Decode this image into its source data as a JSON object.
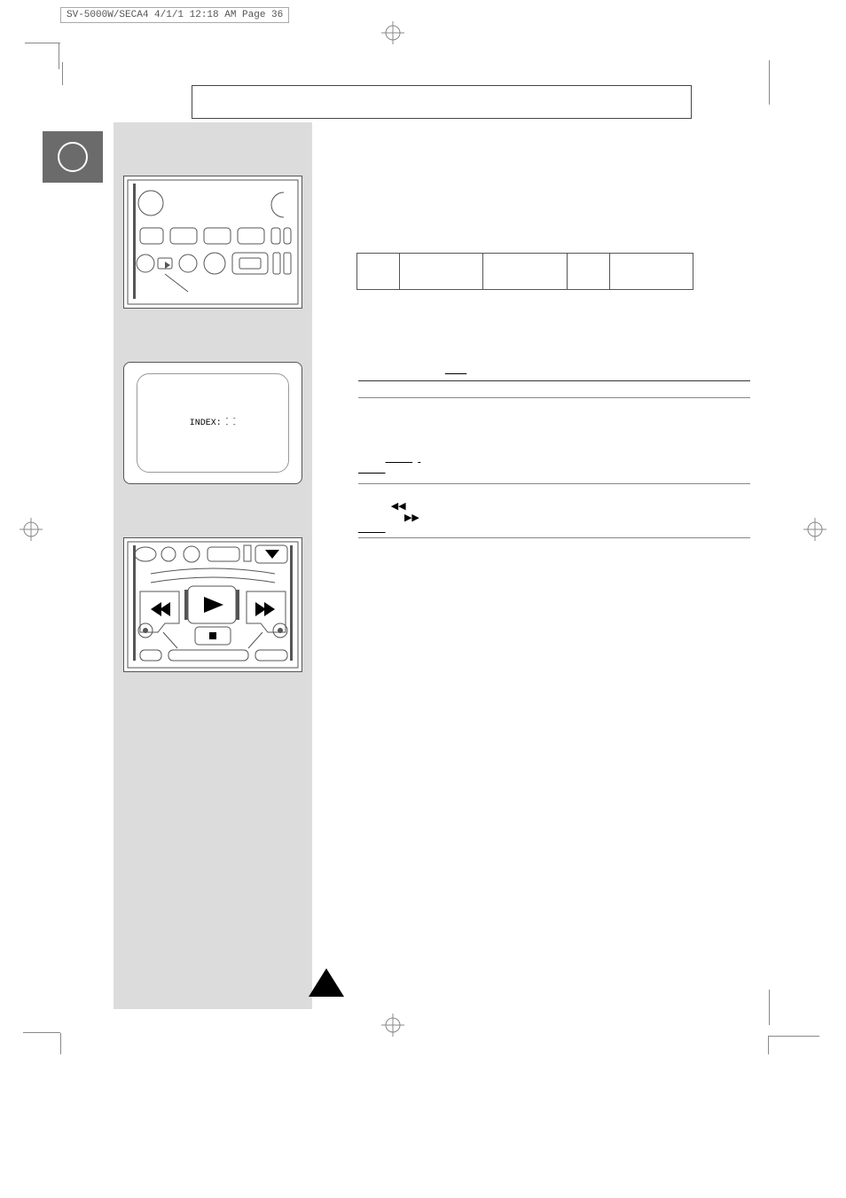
{
  "header": {
    "file_info": "SV-5000W/SECA4  4/1/1 12:18 AM  Page 36"
  },
  "lcd": {
    "label": "INDEX:"
  },
  "rewind_glyph": "◀◀",
  "forward_glyph": "▶▶"
}
